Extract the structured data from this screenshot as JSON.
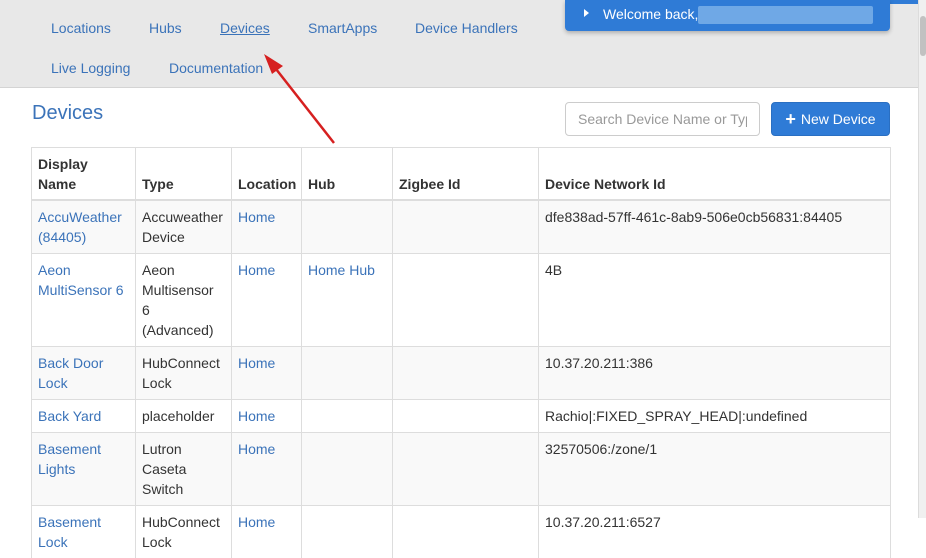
{
  "nav": {
    "items": [
      {
        "label": "Locations"
      },
      {
        "label": "Hubs"
      },
      {
        "label": "Devices"
      },
      {
        "label": "SmartApps"
      },
      {
        "label": "Device Handlers"
      },
      {
        "label": "Live Logging"
      },
      {
        "label": "Documentation"
      }
    ]
  },
  "welcome": {
    "text": "Welcome back,"
  },
  "page": {
    "title": "Devices"
  },
  "search": {
    "placeholder": "Search Device Name or Typ"
  },
  "new_device": {
    "label": "New Device",
    "icon": "plus-icon"
  },
  "table": {
    "headers": [
      "Display Name",
      "Type",
      "Location",
      "Hub",
      "Zigbee Id",
      "Device Network Id"
    ],
    "rows": [
      {
        "name": "AccuWeather (84405)",
        "type": "Accuweather Device",
        "location": "Home",
        "hub": "",
        "zigbee": "",
        "dni": "dfe838ad-57ff-461c-8ab9-506e0cb56831:84405"
      },
      {
        "name": "Aeon MultiSensor 6",
        "type": "Aeon Multisensor 6 (Advanced)",
        "location": "Home",
        "hub": "Home Hub",
        "zigbee": "",
        "dni": "4B"
      },
      {
        "name": "Back Door Lock",
        "type": "HubConnect Lock",
        "location": "Home",
        "hub": "",
        "zigbee": "",
        "dni": "10.37.20.211:386"
      },
      {
        "name": "Back Yard",
        "type": "placeholder",
        "location": "Home",
        "hub": "",
        "zigbee": "",
        "dni": "Rachio|:FIXED_SPRAY_HEAD|:undefined"
      },
      {
        "name": "Basement Lights",
        "type": "Lutron Caseta Switch",
        "location": "Home",
        "hub": "",
        "zigbee": "",
        "dni": "32570506:/zone/1"
      },
      {
        "name": "Basement Lock",
        "type": "HubConnect Lock",
        "location": "Home",
        "hub": "",
        "zigbee": "",
        "dni": "10.37.20.211:6527"
      }
    ]
  },
  "colors": {
    "accent": "#2f7bd6",
    "link": "#3b73b9",
    "annotation_arrow": "#d62020"
  }
}
